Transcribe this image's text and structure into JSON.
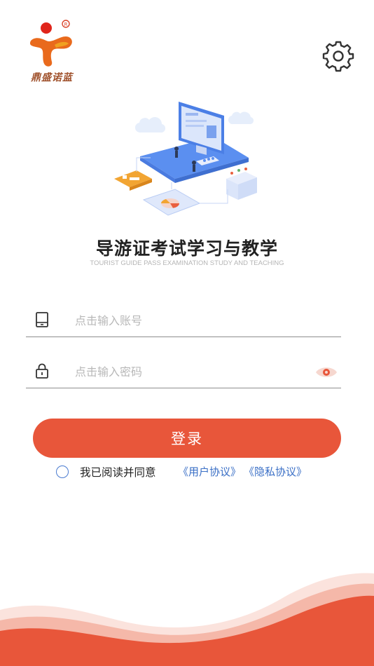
{
  "brand": {
    "name": "鼎盛诺蓝",
    "registered_mark": "R"
  },
  "header": {
    "settings_icon": "gear-icon"
  },
  "hero": {
    "title": "导游证考试学习与教学",
    "subtitle": "TOURIST GUIDE PASS EXAMINATION STUDY AND TEACHING"
  },
  "form": {
    "account": {
      "placeholder": "点击输入账号",
      "value": "",
      "icon": "tablet-icon"
    },
    "password": {
      "placeholder": "点击输入密码",
      "value": "",
      "icon": "lock-icon",
      "toggle_icon": "eye-icon"
    },
    "login_label": "登录"
  },
  "agreement": {
    "checked": false,
    "text": "我已阅读并同意",
    "user_agreement": "《用户协议》",
    "privacy_policy": "《隐私协议》"
  },
  "colors": {
    "primary": "#e8563a",
    "link": "#3a6fc6",
    "title": "#222222",
    "placeholder": "#b8b8b8"
  }
}
